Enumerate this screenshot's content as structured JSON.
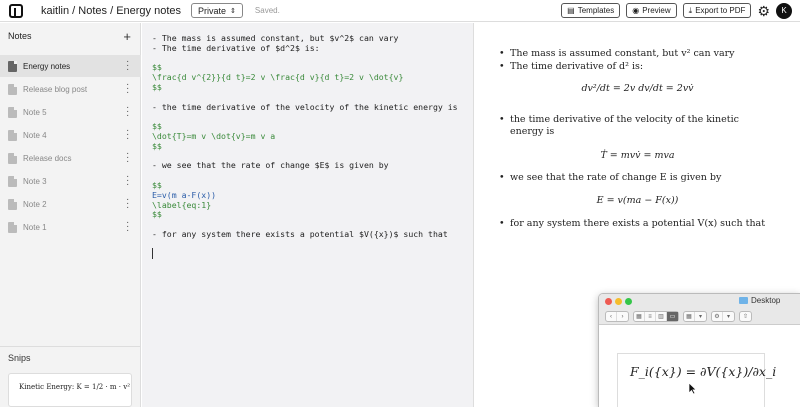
{
  "header": {
    "breadcrumb": "kaitlin / Notes / Energy notes",
    "privacy": "Private",
    "status": "Saved.",
    "templates_label": "Templates",
    "preview_label": "Preview",
    "export_label": "Export to PDF",
    "avatar_initial": "K"
  },
  "sidebar": {
    "title": "Notes",
    "items": [
      {
        "label": "Energy notes"
      },
      {
        "label": "Release blog post"
      },
      {
        "label": "Note 5"
      },
      {
        "label": "Note 4"
      },
      {
        "label": "Release docs"
      },
      {
        "label": "Note 3"
      },
      {
        "label": "Note 2"
      },
      {
        "label": "Note 1"
      }
    ],
    "snips_title": "Snips",
    "snip_text": "Kinetic Energy: K = 1/2 · m · v²"
  },
  "editor": {
    "lines": [
      "- The mass is assumed constant, but $v^2$ can vary",
      "- The time derivative of $d^2$ is:",
      "",
      "$$",
      "\\frac{d v^{2}}{d t}=2 v \\frac{d v}{d t}=2 v \\dot{v}",
      "$$",
      "",
      "- the time derivative of the velocity of the kinetic energy is",
      "",
      "$$",
      "\\dot{T}=m v \\dot{v}=m v a",
      "$$",
      "",
      "- we see that the rate of change $E$ is given by",
      "",
      "$$",
      "E=v(m a-F(x))",
      "\\label{eq:1}",
      "$$",
      "",
      "- for any system there exists a potential $V({x})$ such that"
    ]
  },
  "preview": {
    "b1": "The mass is assumed constant, but v² can vary",
    "b2": "The time derivative of d² is:",
    "eq1": "dv²/dt = 2v dv/dt = 2vv̇",
    "b3": "the time derivative of the velocity of the kinetic energy is",
    "eq2": "Ṫ = mvv̇ = mva",
    "b4": "we see that the rate of change E is given by",
    "eq3": "E = v(ma − F(x))",
    "b5": "for any system there exists a potential V(x) such that"
  },
  "finder": {
    "title": "Desktop",
    "equation": "F_i({x}) = ∂V({x})/∂x_i"
  },
  "colors": {
    "accent_green": "#3a8a3a",
    "accent_blue": "#2a5ca8",
    "editor_bg": "#f2f2f4",
    "sidebar_bg": "#f3f3f3"
  }
}
